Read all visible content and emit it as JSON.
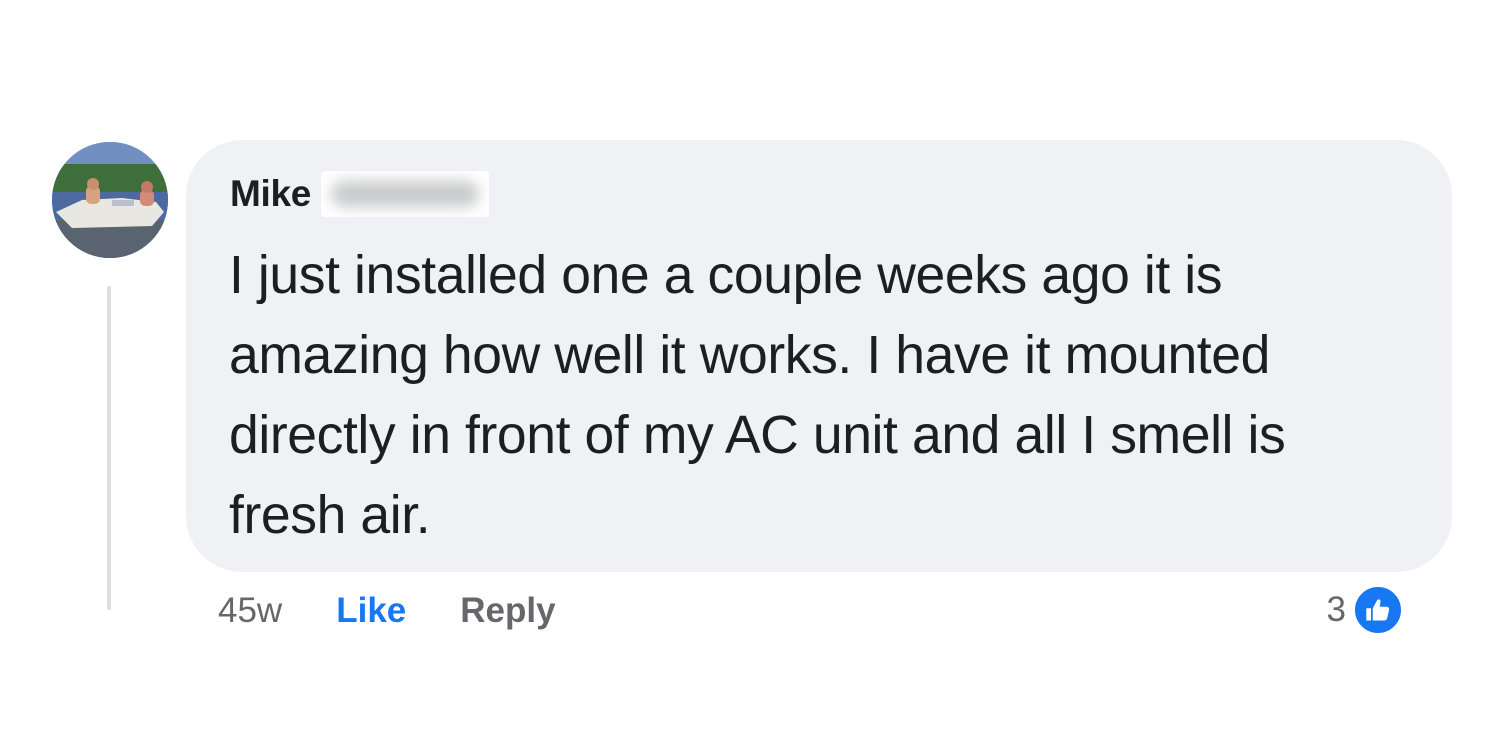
{
  "comment": {
    "author": "Mike",
    "text": "I just installed one a couple weeks ago it is amazing how well it works. I have it mounted directly in front of my AC unit and all I smell is fresh air.",
    "timestamp": "45w",
    "like_label": "Like",
    "reply_label": "Reply",
    "reaction_count": "3",
    "reaction_icon": "thumbs-up-icon"
  },
  "colors": {
    "bubble": "#f0f1f4",
    "text": "#1c1e21",
    "secondary": "#65676b",
    "link": "#1877f2"
  }
}
